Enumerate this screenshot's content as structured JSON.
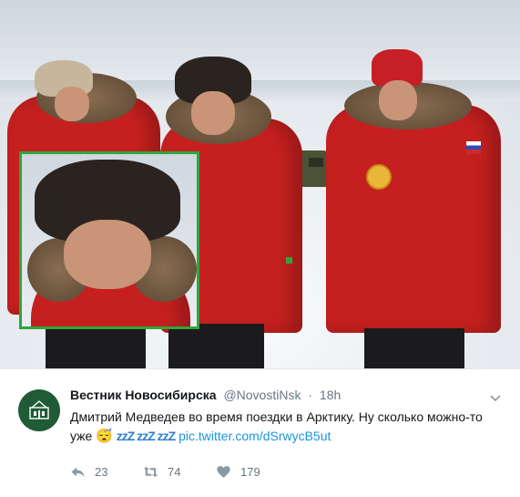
{
  "tweet": {
    "author_name": "Вестник Новосибирска",
    "handle": "@NovostiNsk",
    "separator": "·",
    "time": "18h",
    "text_line1": "Дмитрий Медведев во время поездки в Арктику. Ну сколько можно-то",
    "text_line2_prefix": "уже",
    "emoji": "😴",
    "sleep_z": "zzZ zzZ zzZ",
    "link": "pic.twitter.com/dSrwycB5ut",
    "reply_count": "23",
    "retweet_count": "74",
    "like_count": "179"
  },
  "icons": {
    "menu": "chevron-down-icon",
    "reply": "reply-icon",
    "retweet": "retweet-icon",
    "like": "heart-icon",
    "avatar": "avatar-logo"
  },
  "colors": {
    "coat_red": "#c5201f",
    "inset_border": "#2fa63a",
    "link": "#1b95e0",
    "avatar_bg": "#1f5b36"
  }
}
